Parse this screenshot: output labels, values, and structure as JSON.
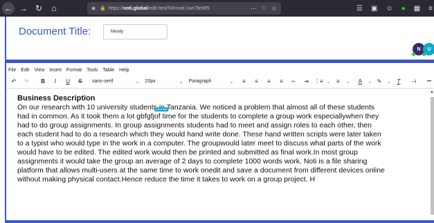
{
  "browser": {
    "url_prefix": "https://",
    "url_host": "noti.global",
    "url_path": "/edit.html?id=noti-1wr79mR5",
    "more_icon": "ellipsis-icon",
    "pocket_icon": "pocket-icon",
    "star_icon": "star-icon"
  },
  "header": {
    "title_label": "Document Title:",
    "title_value": "Moody",
    "avatars": [
      "N",
      "U"
    ]
  },
  "menubar": [
    "File",
    "Edit",
    "View",
    "Insert",
    "Format",
    "Tools",
    "Table",
    "Help"
  ],
  "toolbar": {
    "font_family": "sans-serif",
    "font_size": "20px",
    "block_format": "Paragraph",
    "bold": "B",
    "italic": "I",
    "underline": "U",
    "strike": "S",
    "more": "•••"
  },
  "editor": {
    "heading": "Business Description",
    "cursor_tag": "someone",
    "body": "On our research with 10 university students in Tanzania. We noticed a problem that almost all of these students had in common. As it took them a lot gbfgfjof time for the students to complete a group work especiallywhen they had to do group assignments. In group assignments students had to meet and assign roles to each other, then each student had to do a research which they would hand write done. These hand written scripts were later taken to a typist who would type in the work in a computer. The groupwould later meet to discuss what parts of the work would have to be edited. The edited work would then be printed and submitted as final work.In most group assignments it would take the group an average of 2 days to complete 1000 words work. Noti is a file sharing platform that allows multi-users at the same time to work onedit and save a document from different devices online without making physical contact.Hence reduce the time it takes to work on a group project. H"
  },
  "colors": {
    "accent": "#3a58c9",
    "browser_bg": "#2b2a33"
  }
}
